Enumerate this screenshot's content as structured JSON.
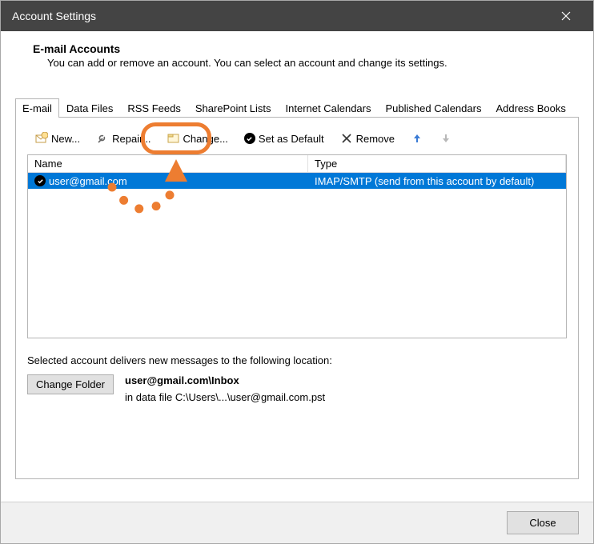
{
  "window": {
    "title": "Account Settings"
  },
  "header": {
    "title": "E-mail Accounts",
    "description": "You can add or remove an account. You can select an account and change its settings."
  },
  "tabs": {
    "items": [
      {
        "label": "E-mail"
      },
      {
        "label": "Data Files"
      },
      {
        "label": "RSS Feeds"
      },
      {
        "label": "SharePoint Lists"
      },
      {
        "label": "Internet Calendars"
      },
      {
        "label": "Published Calendars"
      },
      {
        "label": "Address Books"
      }
    ]
  },
  "toolbar": {
    "new_label": "New...",
    "repair_label": "Repair...",
    "change_label": "Change...",
    "default_label": "Set as Default",
    "remove_label": "Remove"
  },
  "list": {
    "col_name": "Name",
    "col_type": "Type",
    "rows": [
      {
        "name": "user@gmail.com",
        "type": "IMAP/SMTP (send from this account by default)"
      }
    ]
  },
  "delivery": {
    "intro": "Selected account delivers new messages to the following location:",
    "change_folder_label": "Change Folder",
    "location": "user@gmail.com\\Inbox",
    "datafile": "in data file C:\\Users\\...\\user@gmail.com.pst"
  },
  "footer": {
    "close_label": "Close"
  }
}
